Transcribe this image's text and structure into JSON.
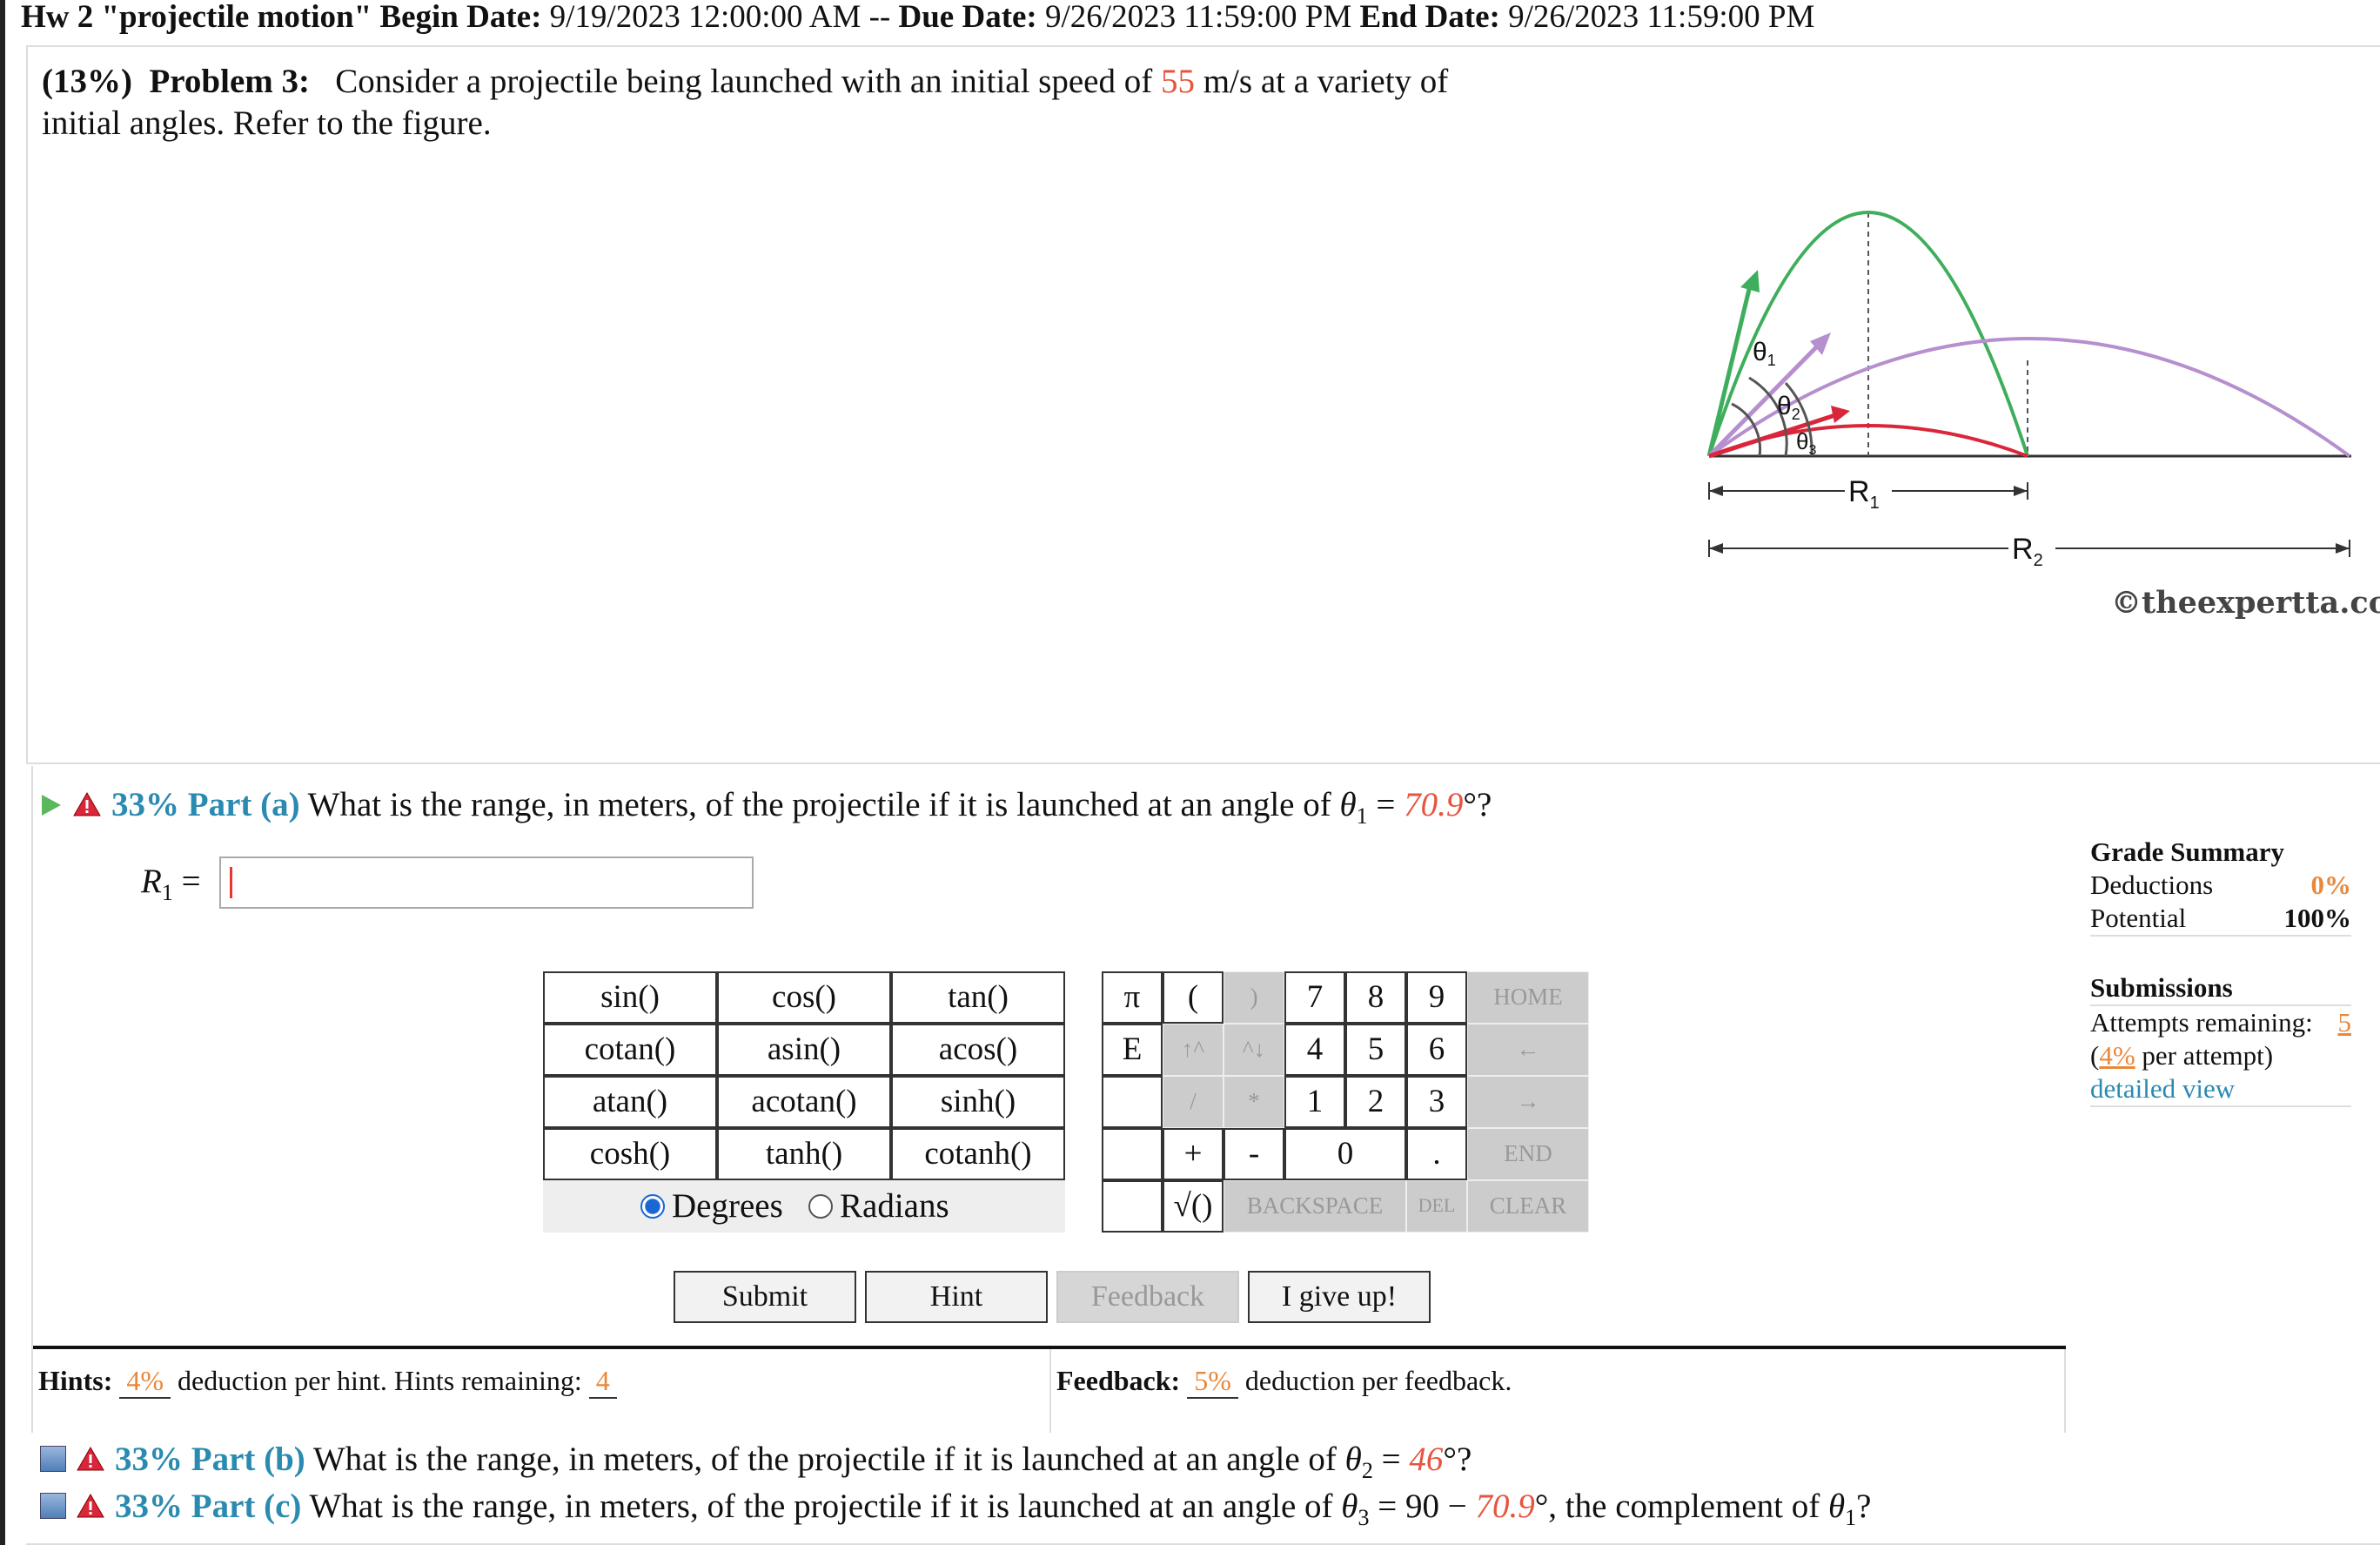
{
  "header": {
    "hw_label": "Hw 2 \"projectile motion\"",
    "begin_label": "Begin Date:",
    "begin_value": "9/19/2023 12:00:00 AM",
    "sep": "--",
    "due_label": "Due Date:",
    "due_value": "9/26/2023 11:59:00 PM",
    "end_label": "End Date:",
    "end_value": "9/26/2023 11:59:00 PM"
  },
  "problem": {
    "weight": "(13%)",
    "label": "Problem 3:",
    "text_before": "Consider a projectile being launched with an initial speed of",
    "speed": "55",
    "text_after": "m/s at a variety of initial angles. Refer to the figure.",
    "copyright": "©theexpertta.com",
    "figure_labels": {
      "theta1": "θ",
      "theta1_sub": "1",
      "theta2": "θ",
      "theta2_sub": "2",
      "theta3": "θ",
      "theta3_sub": "3",
      "r1": "R",
      "r1_sub": "1",
      "r2": "R",
      "r2_sub": "2"
    }
  },
  "part_a": {
    "percent": "33%",
    "label": "Part (a)",
    "question": "What is the range, in meters, of the projectile if it is launched at an angle of",
    "theta": "θ",
    "theta_sub": "1",
    "eq": "=",
    "angle": "70.9",
    "unit": "°?",
    "answer_label": "R",
    "answer_sub": "1",
    "answer_eq": "=",
    "answer_value": ""
  },
  "keypad": {
    "functions": [
      "sin()",
      "cos()",
      "tan()",
      "cotan()",
      "asin()",
      "acos()",
      "atan()",
      "acotan()",
      "sinh()",
      "cosh()",
      "tanh()",
      "cotanh()"
    ],
    "pi": "π",
    "e": "E",
    "open_paren": "(",
    "close_paren": ")",
    "up": "↑^",
    "down": "^↓",
    "slash": "/",
    "star": "*",
    "plus": "+",
    "minus": "-",
    "sqrt": "√()",
    "digits": [
      "7",
      "8",
      "9",
      "4",
      "5",
      "6",
      "1",
      "2",
      "3",
      "0",
      "."
    ],
    "home": "HOME",
    "left": "←",
    "right": "→",
    "end": "END",
    "backspace": "BACKSPACE",
    "del": "DEL",
    "clear": "CLEAR",
    "degrees": "Degrees",
    "radians": "Radians",
    "selected_mode": "Degrees"
  },
  "buttons": {
    "submit": "Submit",
    "hint": "Hint",
    "feedback": "Feedback",
    "give_up": "I give up!"
  },
  "hints": {
    "label": "Hints:",
    "pct": "4%",
    "text": "deduction per hint. Hints remaining:",
    "remaining": "4"
  },
  "feedback": {
    "label": "Feedback:",
    "pct": "5%",
    "text": "deduction per feedback."
  },
  "grade_summary": {
    "title": "Grade Summary",
    "deductions_label": "Deductions",
    "deductions_value": "0%",
    "potential_label": "Potential",
    "potential_value": "100%",
    "submissions_title": "Submissions",
    "attempts_label": "Attempts remaining:",
    "attempts_value": "5",
    "per_attempt_pct": "4%",
    "per_attempt_text": "per attempt)",
    "open_paren": "(",
    "detailed_view": "detailed view"
  },
  "part_b": {
    "percent": "33%",
    "label": "Part (b)",
    "question": "What is the range, in meters, of the projectile if it is launched at an angle of",
    "theta": "θ",
    "theta_sub": "2",
    "eq": "=",
    "angle": "46",
    "unit": "°?"
  },
  "part_c": {
    "percent": "33%",
    "label": "Part (c)",
    "question": "What is the range, in meters, of the projectile if it is launched at an angle of",
    "theta": "θ",
    "theta_sub": "3",
    "eq": "= 90 −",
    "angle": "70.9",
    "tail": "°, the complement of",
    "theta1": "θ",
    "theta1_sub": "1",
    "q": "?"
  },
  "colors": {
    "accent_blue": "#2a8ab0",
    "value_red": "#e8543f",
    "value_orange": "#e8883c",
    "green_arc": "#3fae5c",
    "purple_arc": "#b68fcf",
    "red_arc": "#d9263a"
  }
}
